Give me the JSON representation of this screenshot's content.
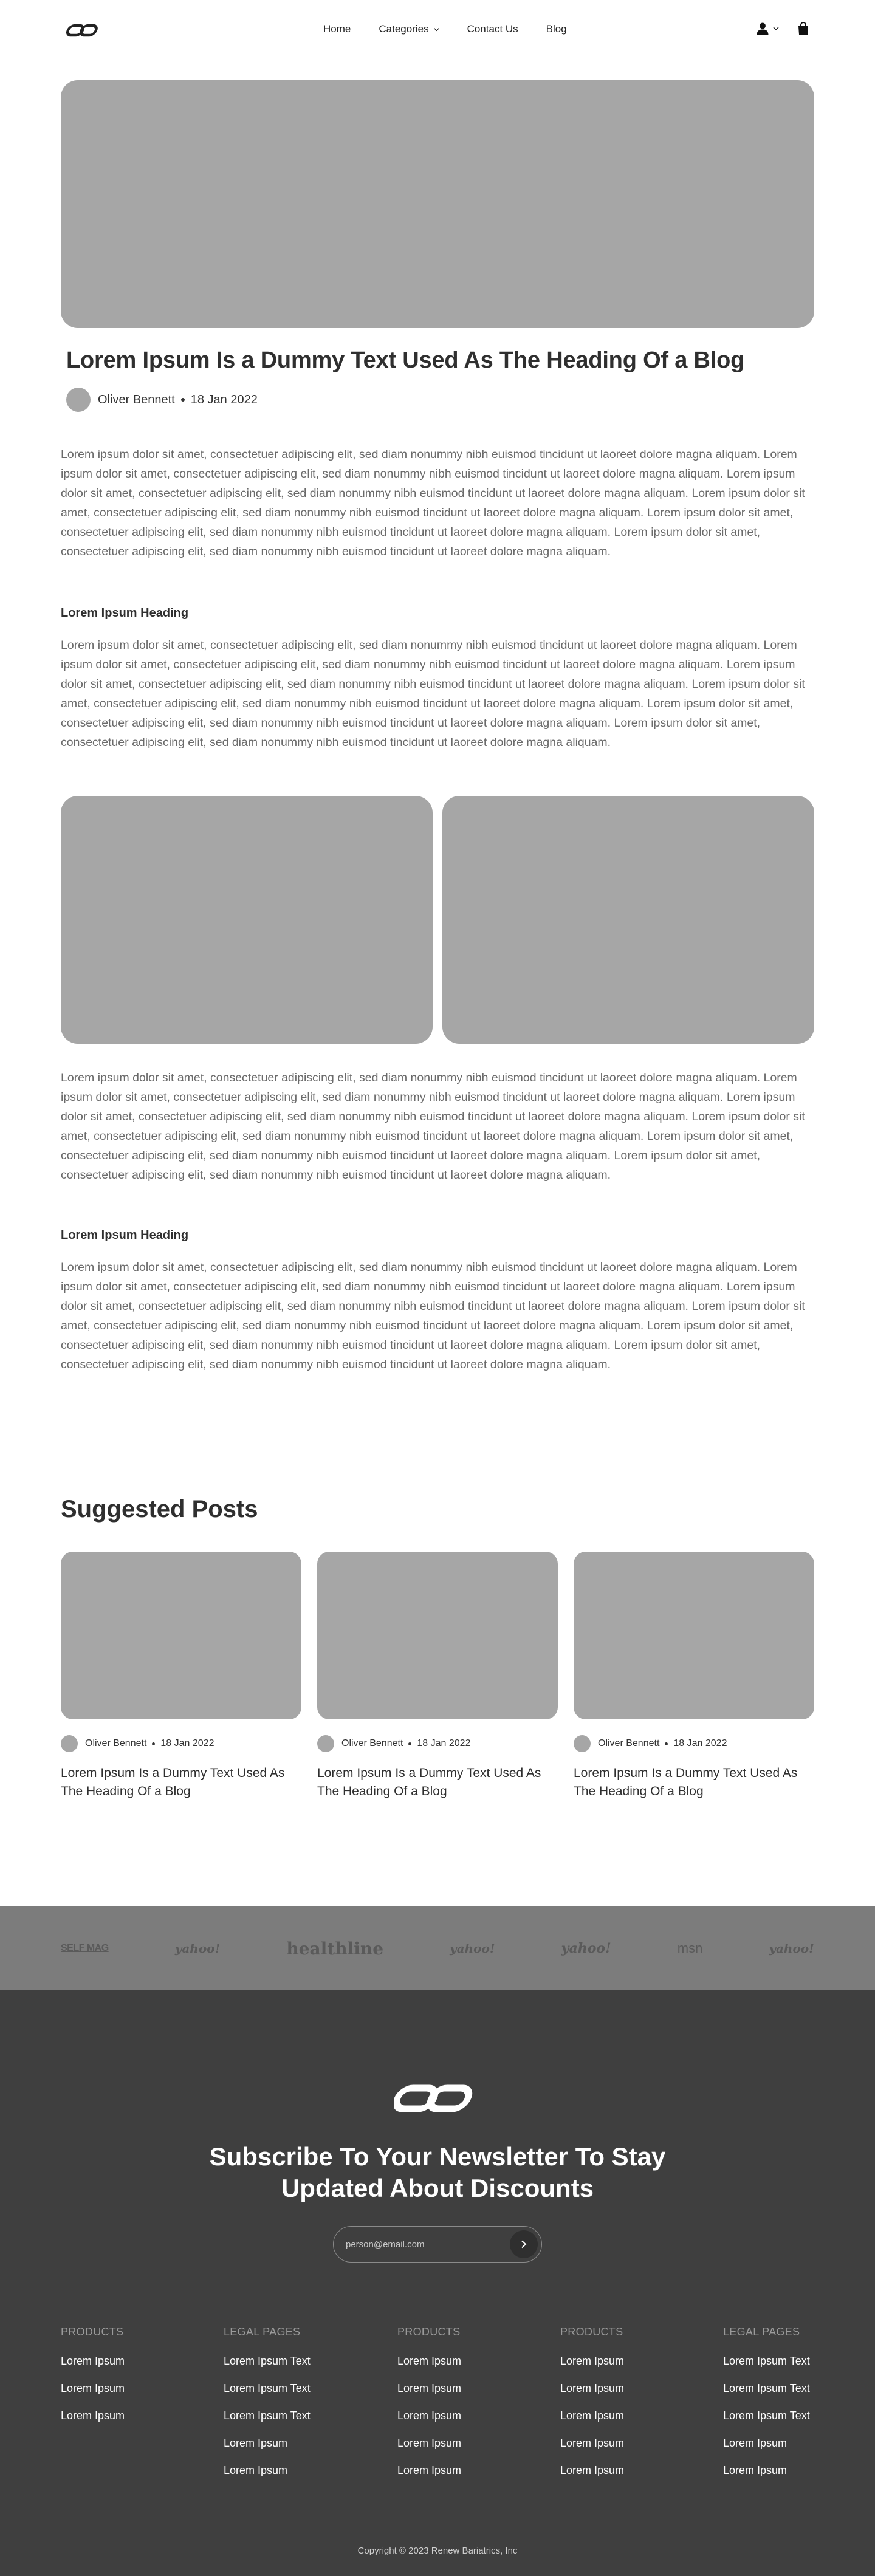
{
  "nav": {
    "links": [
      {
        "label": "Home"
      },
      {
        "label": "Categories"
      },
      {
        "label": "Contact Us"
      },
      {
        "label": "Blog"
      }
    ]
  },
  "post": {
    "title": "Lorem Ipsum Is a Dummy Text Used As The Heading Of a Blog",
    "author": "Oliver Bennett",
    "date": "18 Jan 2022",
    "paragraph": "Lorem ipsum dolor sit amet, consectetuer adipiscing elit, sed diam nonummy nibh euismod tincidunt ut laoreet dolore magna aliquam. Lorem ipsum dolor sit amet, consectetuer adipiscing elit, sed diam nonummy nibh euismod tincidunt ut laoreet dolore magna aliquam. Lorem ipsum dolor sit amet, consectetuer adipiscing elit, sed diam nonummy nibh euismod tincidunt ut laoreet dolore magna aliquam. Lorem ipsum dolor sit amet, consectetuer adipiscing elit, sed diam nonummy nibh euismod tincidunt ut laoreet dolore magna aliquam. Lorem ipsum dolor sit amet, consectetuer adipiscing elit, sed diam nonummy nibh euismod tincidunt ut laoreet dolore magna aliquam. Lorem ipsum dolor sit amet, consectetuer adipiscing elit, sed diam nonummy nibh euismod tincidunt ut laoreet dolore magna aliquam.",
    "sub_heading": "Lorem Ipsum Heading"
  },
  "suggested": {
    "title": "Suggested Posts",
    "cards": [
      {
        "author": "Oliver Bennett",
        "date": "18 Jan 2022",
        "title": "Lorem Ipsum Is a Dummy Text Used As The Heading Of a Blog"
      },
      {
        "author": "Oliver Bennett",
        "date": "18 Jan 2022",
        "title": "Lorem Ipsum Is a Dummy Text Used As The Heading Of a Blog"
      },
      {
        "author": "Oliver Bennett",
        "date": "18 Jan 2022",
        "title": "Lorem Ipsum Is a Dummy Text Used As The Heading Of a Blog"
      }
    ]
  },
  "brands": [
    "SELF MAG",
    "yahoo!",
    "healthline",
    "yahoo!",
    "yahoo!",
    "msn",
    "yahoo!"
  ],
  "newsletter": {
    "title_line1": "Subscribe To Your Newsletter To Stay",
    "title_line2": "Updated About Discounts",
    "placeholder": "person@email.com"
  },
  "footer": {
    "columns": [
      {
        "heading": "PRODUCTS",
        "items": [
          "Lorem Ipsum",
          "Lorem Ipsum",
          "Lorem Ipsum"
        ]
      },
      {
        "heading": "LEGAL PAGES",
        "items": [
          "Lorem Ipsum Text",
          "Lorem Ipsum Text",
          "Lorem Ipsum Text",
          "Lorem Ipsum",
          "Lorem Ipsum"
        ]
      },
      {
        "heading": "PRODUCTS",
        "items": [
          "Lorem Ipsum",
          "Lorem Ipsum",
          "Lorem Ipsum",
          "Lorem Ipsum",
          "Lorem Ipsum"
        ]
      },
      {
        "heading": "PRODUCTS",
        "items": [
          "Lorem Ipsum",
          "Lorem Ipsum",
          "Lorem Ipsum",
          "Lorem Ipsum",
          "Lorem Ipsum"
        ]
      },
      {
        "heading": "LEGAL PAGES",
        "items": [
          "Lorem Ipsum Text",
          "Lorem Ipsum Text",
          "Lorem Ipsum Text",
          "Lorem Ipsum",
          "Lorem Ipsum"
        ]
      }
    ],
    "copyright": "Copyright © 2023 Renew Bariatrics, Inc"
  },
  "colors": {
    "placeholder_gray": "#a6a6a6",
    "brand_strip": "#7c7c7c",
    "footer_bg": "#3f3f3f"
  }
}
